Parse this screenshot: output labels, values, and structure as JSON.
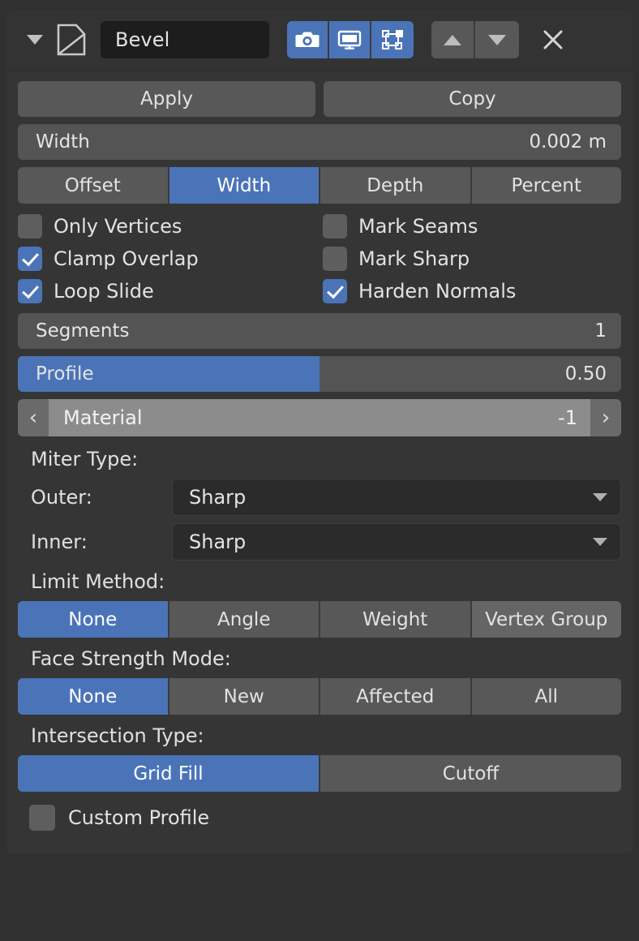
{
  "colors": {
    "accent_blue": "#4b74b8",
    "panel_bg": "#353535",
    "header_bg": "#333333",
    "button_gray": "#585858",
    "field_gray": "#545454",
    "dropdown_dark": "#2b2b2b",
    "hover_gray": "#656565",
    "material_hover": "#8c8c8c",
    "text": "#e2e2e2",
    "window_bg": "#303030"
  },
  "header": {
    "expand_icon": "triangle-down-icon",
    "modifier_icon": "bevel-modifier-icon",
    "name": "Bevel",
    "toggles": [
      {
        "name": "render-toggle",
        "icon": "camera-icon",
        "enabled": true
      },
      {
        "name": "realtime-toggle",
        "icon": "monitor-icon",
        "enabled": true
      },
      {
        "name": "edit-mode-toggle",
        "icon": "edit-mode-icon",
        "enabled": true
      }
    ],
    "move_up_icon": "triangle-up-icon",
    "move_down_icon": "triangle-down-icon",
    "close_icon": "close-x-icon"
  },
  "actions": {
    "apply_label": "Apply",
    "copy_label": "Copy"
  },
  "width_field": {
    "label": "Width",
    "value": "0.002 m",
    "fill_percent": 0
  },
  "offset_type": {
    "options": [
      "Offset",
      "Width",
      "Depth",
      "Percent"
    ],
    "selected": "Width"
  },
  "checkboxes": [
    {
      "label": "Only Vertices",
      "checked": false
    },
    {
      "label": "Mark Seams",
      "checked": false
    },
    {
      "label": "Clamp Overlap",
      "checked": true
    },
    {
      "label": "Mark Sharp",
      "checked": false
    },
    {
      "label": "Loop Slide",
      "checked": true
    },
    {
      "label": "Harden Normals",
      "checked": true
    }
  ],
  "segments": {
    "label": "Segments",
    "value": "1"
  },
  "profile": {
    "label": "Profile",
    "value": "0.50",
    "fill_percent": 50
  },
  "material": {
    "label": "Material",
    "value": "-1",
    "prev_icon": "chevron-left-icon",
    "next_icon": "chevron-right-icon"
  },
  "miter": {
    "heading": "Miter Type:",
    "outer_label": "Outer:",
    "outer_value": "Sharp",
    "inner_label": "Inner:",
    "inner_value": "Sharp",
    "chevron_icon": "chevron-down-icon"
  },
  "limit_method": {
    "heading": "Limit Method:",
    "options": [
      "None",
      "Angle",
      "Weight",
      "Vertex Group"
    ],
    "selected": "None",
    "hovered": "Vertex Group"
  },
  "face_strength": {
    "heading": "Face Strength Mode:",
    "options": [
      "None",
      "New",
      "Affected",
      "All"
    ],
    "selected": "None"
  },
  "intersection": {
    "heading": "Intersection Type:",
    "options": [
      "Grid Fill",
      "Cutoff"
    ],
    "selected": "Grid Fill"
  },
  "custom_profile": {
    "label": "Custom Profile",
    "checked": false
  }
}
